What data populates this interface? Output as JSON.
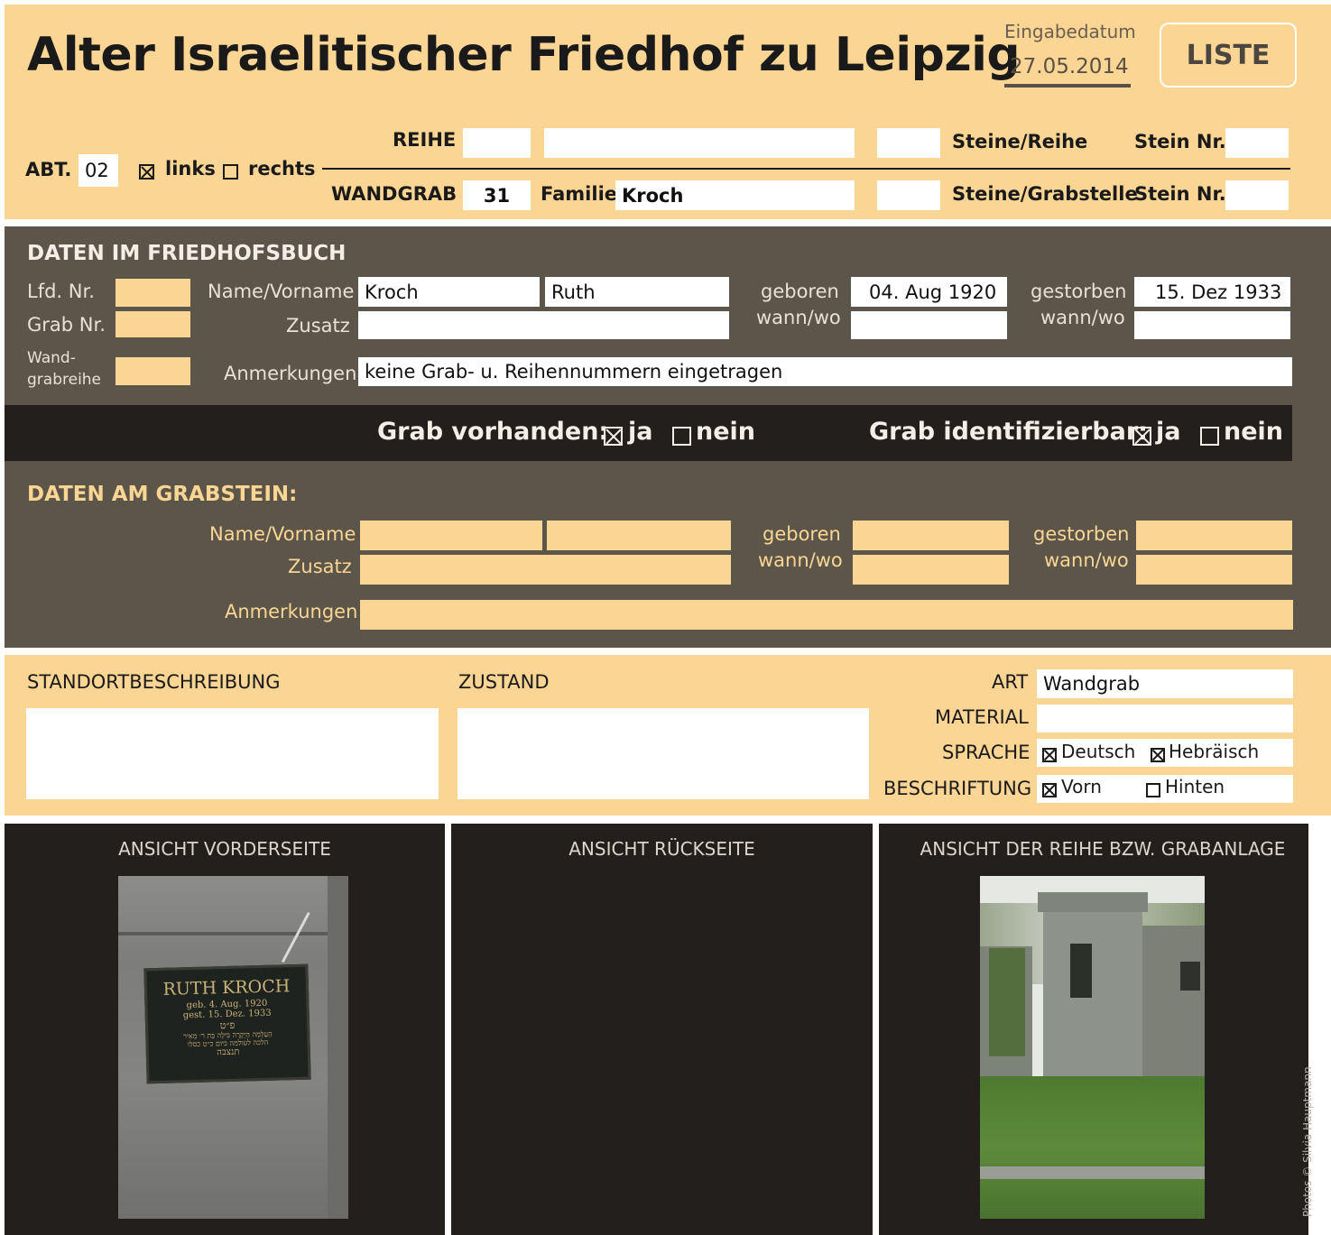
{
  "header": {
    "title": "Alter Israelitischer Friedhof zu Leipzig",
    "entry_date_label": "Eingabedatum",
    "entry_date_value": "27.05.2014",
    "list_button": "LISTE",
    "abt_label": "ABT.",
    "abt_value": "02",
    "left_label": "links",
    "left_checked": true,
    "right_label": "rechts",
    "right_checked": false,
    "reihe_label": "REIHE",
    "reihe_value": "",
    "reihe_extra": "",
    "reihe_count": "",
    "steine_reihe_label": "Steine/Reihe",
    "stein_nr_label_1": "Stein Nr.",
    "stein_nr_value_1": "",
    "wandgrab_label": "WANDGRAB",
    "wandgrab_value": "31",
    "familie_label": "Familie",
    "familie_value": "Kroch",
    "grab_count": "",
    "steine_grabstelle_label": "Steine/Grabstelle",
    "stein_nr_label_2": "Stein Nr.",
    "stein_nr_value_2": ""
  },
  "friedhofsbuch": {
    "heading": "DATEN IM FRIEDHOFSBUCH",
    "lfd_nr_label": "Lfd. Nr.",
    "lfd_nr_value": "",
    "grab_nr_label": "Grab Nr.",
    "grab_nr_value": "",
    "wandgrabreihe_label_1": "Wand-",
    "wandgrabreihe_label_2": "grabreihe",
    "wandgrabreihe_value": "",
    "name_label": "Name/Vorname",
    "name_value": "Kroch",
    "vorname_value": "Ruth",
    "zusatz_label": "Zusatz",
    "zusatz_value": "",
    "anmerkungen_label": "Anmerkungen",
    "anmerkungen_value": "keine Grab- u. Reihennummern eingetragen",
    "geboren_label": "geboren",
    "geboren_value": "04. Aug 1920",
    "geboren_wo_label": "wann/wo",
    "geboren_wo_value": "",
    "gestorben_label": "gestorben",
    "gestorben_value": "15. Dez 1933",
    "gestorben_wo_label": "wann/wo",
    "gestorben_wo_value": ""
  },
  "status_bar": {
    "grab_vorhanden_label": "Grab vorhanden:",
    "grab_vorhanden_ja": "ja",
    "grab_vorhanden_nein": "nein",
    "grab_vorhanden_value": "ja",
    "grab_identifizierbar_label": "Grab identifizierbar:",
    "grab_identifizierbar_ja": "ja",
    "grab_identifizierbar_nein": "nein",
    "grab_identifizierbar_value": "ja"
  },
  "grabstein": {
    "heading": "DATEN AM GRABSTEIN:",
    "name_label": "Name/Vorname",
    "name_value": "",
    "vorname_value": "",
    "zusatz_label": "Zusatz",
    "zusatz_value": "",
    "anmerkungen_label": "Anmerkungen",
    "anmerkungen_value": "",
    "geboren_label": "geboren",
    "geboren_value": "",
    "geboren_wo_label": "wann/wo",
    "geboren_wo_value": "",
    "gestorben_label": "gestorben",
    "gestorben_value": "",
    "gestorben_wo_label": "wann/wo",
    "gestorben_wo_value": ""
  },
  "details": {
    "standort_label": "STANDORTBESCHREIBUNG",
    "standort_value": "",
    "zustand_label": "ZUSTAND",
    "zustand_value": "",
    "art_label": "ART",
    "art_value": "Wandgrab",
    "material_label": "MATERIAL",
    "material_value": "",
    "sprache_label": "SPRACHE",
    "sprache_deutsch": "Deutsch",
    "sprache_deutsch_checked": true,
    "sprache_hebraeisch": "Hebräisch",
    "sprache_hebraeisch_checked": true,
    "beschriftung_label": "BESCHRIFTUNG",
    "beschriftung_vorn": "Vorn",
    "beschriftung_vorn_checked": true,
    "beschriftung_hinten": "Hinten",
    "beschriftung_hinten_checked": false
  },
  "photos": {
    "front_title": "ANSICHT VORDERSEITE",
    "back_title": "ANSICHT RÜCKSEITE",
    "row_title": "ANSICHT DER REIHE BZW. GRABANLAGE",
    "plaque_name": "RUTH KROCH",
    "plaque_born": "geb. 4. Aug. 1920",
    "plaque_died": "gest. 15. Dez. 1933",
    "plaque_hebrew_1": "פ״ט",
    "plaque_hebrew_2": "הַעַלְמָה הַיְקָרָה בִּילָה בַּת ר׳ מֵאִיר",
    "plaque_hebrew_3": "הלכה לעולמה ביום כ״ט כסלו",
    "plaque_hebrew_4": "תנצבה",
    "credit": "Photos © Silvia Hauptmann"
  },
  "colors": {
    "yellow": "#fbd594",
    "brown": "#5c5549",
    "black": "#231f1c"
  }
}
